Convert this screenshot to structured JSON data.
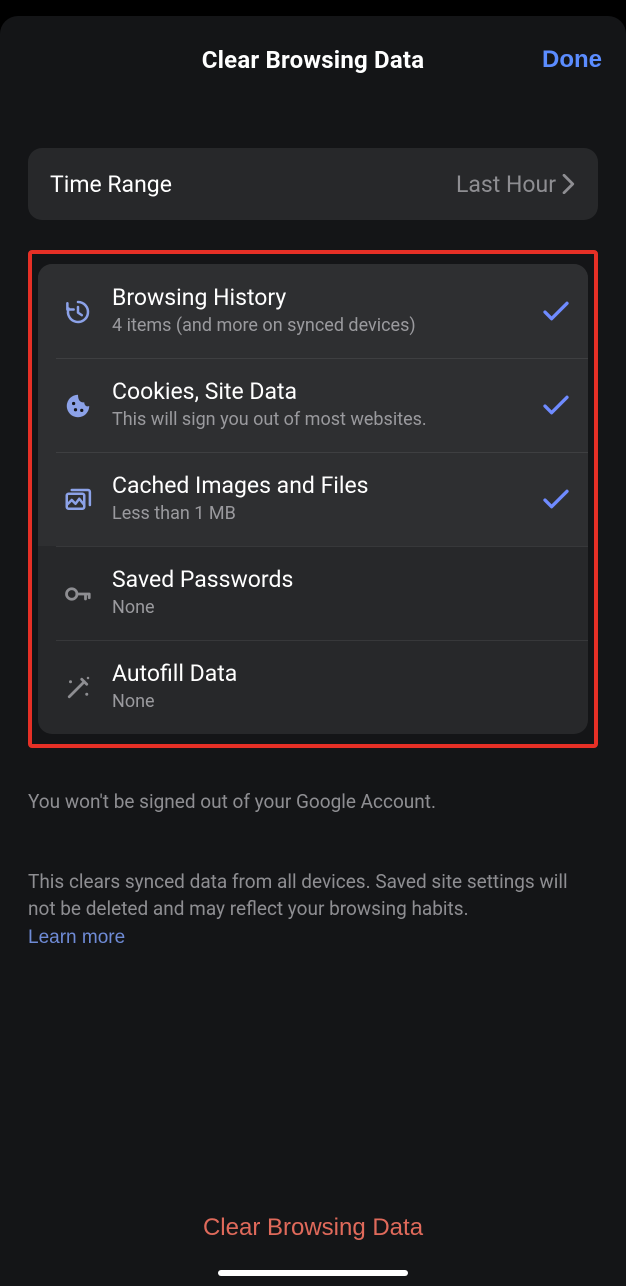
{
  "header": {
    "title": "Clear Browsing Data",
    "done": "Done"
  },
  "timeRange": {
    "label": "Time Range",
    "value": "Last Hour"
  },
  "options": [
    {
      "icon": "history-icon",
      "title": "Browsing History",
      "sub": "4 items (and more on synced devices)",
      "selected": true,
      "iconColor": "#8ca2e8"
    },
    {
      "icon": "cookie-icon",
      "title": "Cookies, Site Data",
      "sub": "This will sign you out of most websites.",
      "selected": true,
      "iconColor": "#8ca2e8"
    },
    {
      "icon": "images-icon",
      "title": "Cached Images and Files",
      "sub": "Less than 1 MB",
      "selected": true,
      "iconColor": "#8ca2e8"
    },
    {
      "icon": "key-icon",
      "title": "Saved Passwords",
      "sub": "None",
      "selected": false,
      "iconColor": "#8e8e92"
    },
    {
      "icon": "wand-icon",
      "title": "Autofill Data",
      "sub": "None",
      "selected": false,
      "iconColor": "#8e8e92"
    }
  ],
  "footer": {
    "line1": "You won't be signed out of your Google Account.",
    "line2": "This clears synced data from all devices. Saved site settings will not be deleted and may reflect your browsing habits.",
    "learnMore": "Learn more"
  },
  "clearButton": "Clear Browsing Data",
  "colors": {
    "accent": "#5b8cff",
    "danger": "#e06a5b",
    "highlight": "#e63026"
  }
}
